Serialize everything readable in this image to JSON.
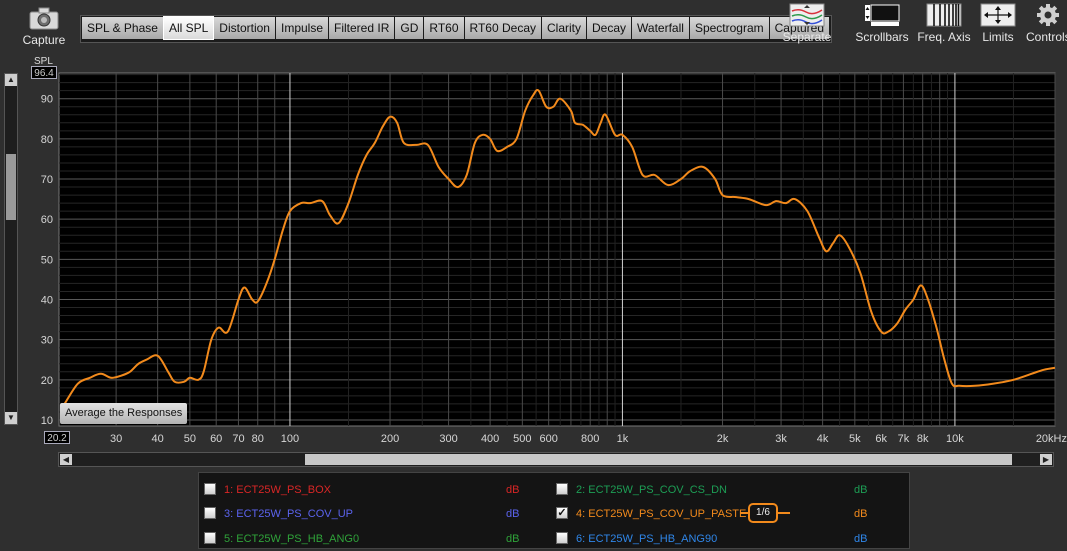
{
  "toolbar": {
    "capture_label": "Capture",
    "tabs": [
      {
        "label": "SPL & Phase",
        "active": false
      },
      {
        "label": "All SPL",
        "active": true
      },
      {
        "label": "Distortion",
        "active": false
      },
      {
        "label": "Impulse",
        "active": false
      },
      {
        "label": "Filtered IR",
        "active": false
      },
      {
        "label": "GD",
        "active": false
      },
      {
        "label": "RT60",
        "active": false
      },
      {
        "label": "RT60 Decay",
        "active": false
      },
      {
        "label": "Clarity",
        "active": false
      },
      {
        "label": "Decay",
        "active": false
      },
      {
        "label": "Waterfall",
        "active": false
      },
      {
        "label": "Spectrogram",
        "active": false
      },
      {
        "label": "Captured",
        "active": false
      }
    ],
    "tools": {
      "separate": {
        "label": "Separate",
        "icon": "separate-traces-icon"
      },
      "scrollbars": {
        "label": "Scrollbars",
        "icon": "scrollbars-icon"
      },
      "freq_axis": {
        "label": "Freq. Axis",
        "icon": "frequency-axis-icon"
      },
      "limits": {
        "label": "Limits",
        "icon": "limits-arrows-icon"
      },
      "controls": {
        "label": "Controls",
        "icon": "gear-icon"
      }
    }
  },
  "graph": {
    "y_unit": "SPL",
    "y_top_value": "96.4",
    "y_bottom_value": "20.2",
    "average_button": "Average the Responses"
  },
  "chart_data": {
    "type": "line",
    "x_scale": "log",
    "xlim": [
      20.2,
      20000
    ],
    "ylim": [
      8.5,
      96.4
    ],
    "xlabel": "",
    "ylabel": "SPL",
    "x_ticks": [
      {
        "value": 30,
        "label": "30"
      },
      {
        "value": 40,
        "label": "40"
      },
      {
        "value": 50,
        "label": "50"
      },
      {
        "value": 60,
        "label": "60"
      },
      {
        "value": 70,
        "label": "70"
      },
      {
        "value": 80,
        "label": "80"
      },
      {
        "value": 100,
        "label": "100"
      },
      {
        "value": 200,
        "label": "200"
      },
      {
        "value": 300,
        "label": "300"
      },
      {
        "value": 400,
        "label": "400"
      },
      {
        "value": 500,
        "label": "500"
      },
      {
        "value": 600,
        "label": "600"
      },
      {
        "value": 800,
        "label": "800"
      },
      {
        "value": 1000,
        "label": "1k"
      },
      {
        "value": 2000,
        "label": "2k"
      },
      {
        "value": 3000,
        "label": "3k"
      },
      {
        "value": 4000,
        "label": "4k"
      },
      {
        "value": 5000,
        "label": "5k"
      },
      {
        "value": 6000,
        "label": "6k"
      },
      {
        "value": 7000,
        "label": "7k"
      },
      {
        "value": 8000,
        "label": "8k"
      },
      {
        "value": 10000,
        "label": "10k"
      },
      {
        "value": 20000,
        "label": "20kHz"
      }
    ],
    "y_ticks": [
      10,
      20,
      30,
      40,
      50,
      60,
      70,
      80,
      90
    ],
    "grid": true,
    "series": [
      {
        "color": "#f28a1c",
        "points": [
          [
            21,
            14
          ],
          [
            23,
            19
          ],
          [
            25,
            20.5
          ],
          [
            27,
            21.5
          ],
          [
            29,
            20.5
          ],
          [
            31,
            21
          ],
          [
            33,
            22
          ],
          [
            35,
            24
          ],
          [
            37,
            25
          ],
          [
            40,
            26
          ],
          [
            43,
            22
          ],
          [
            45,
            19.5
          ],
          [
            48,
            19.5
          ],
          [
            50,
            20.5
          ],
          [
            53,
            20
          ],
          [
            55,
            22
          ],
          [
            58,
            30
          ],
          [
            61,
            33
          ],
          [
            65,
            32
          ],
          [
            70,
            40
          ],
          [
            73,
            43
          ],
          [
            77,
            40
          ],
          [
            80,
            39.5
          ],
          [
            85,
            44
          ],
          [
            90,
            50
          ],
          [
            95,
            57
          ],
          [
            100,
            62
          ],
          [
            108,
            64
          ],
          [
            115,
            64
          ],
          [
            125,
            64.5
          ],
          [
            132,
            61
          ],
          [
            140,
            59
          ],
          [
            150,
            64
          ],
          [
            160,
            71
          ],
          [
            170,
            76
          ],
          [
            180,
            79
          ],
          [
            190,
            83
          ],
          [
            200,
            85.5
          ],
          [
            210,
            84
          ],
          [
            220,
            79
          ],
          [
            240,
            78.5
          ],
          [
            260,
            78.5
          ],
          [
            280,
            73
          ],
          [
            300,
            70
          ],
          [
            320,
            68
          ],
          [
            340,
            71
          ],
          [
            360,
            79
          ],
          [
            380,
            81
          ],
          [
            400,
            80
          ],
          [
            420,
            77
          ],
          [
            450,
            78
          ],
          [
            480,
            80
          ],
          [
            510,
            87
          ],
          [
            540,
            91
          ],
          [
            560,
            92
          ],
          [
            590,
            88
          ],
          [
            620,
            88
          ],
          [
            650,
            90
          ],
          [
            700,
            87
          ],
          [
            720,
            84
          ],
          [
            760,
            83.5
          ],
          [
            800,
            82
          ],
          [
            830,
            81
          ],
          [
            860,
            84
          ],
          [
            890,
            86
          ],
          [
            950,
            81
          ],
          [
            1000,
            81
          ],
          [
            1070,
            78
          ],
          [
            1150,
            71
          ],
          [
            1250,
            71
          ],
          [
            1370,
            68.5
          ],
          [
            1500,
            70
          ],
          [
            1600,
            72
          ],
          [
            1750,
            73
          ],
          [
            1900,
            70
          ],
          [
            2000,
            66
          ],
          [
            2200,
            65.5
          ],
          [
            2400,
            65
          ],
          [
            2700,
            63.5
          ],
          [
            2900,
            64.5
          ],
          [
            3100,
            64
          ],
          [
            3300,
            65
          ],
          [
            3600,
            62
          ],
          [
            3900,
            55.5
          ],
          [
            4100,
            52
          ],
          [
            4300,
            54
          ],
          [
            4500,
            56
          ],
          [
            4800,
            53
          ],
          [
            5200,
            46.5
          ],
          [
            5600,
            37
          ],
          [
            6000,
            32
          ],
          [
            6300,
            32
          ],
          [
            6700,
            34
          ],
          [
            7100,
            37.5
          ],
          [
            7500,
            40
          ],
          [
            7900,
            43.5
          ],
          [
            8300,
            40
          ],
          [
            8800,
            33
          ],
          [
            9300,
            25
          ],
          [
            9800,
            19
          ],
          [
            10300,
            18.5
          ],
          [
            11500,
            18.5
          ],
          [
            13000,
            19
          ],
          [
            15000,
            20
          ],
          [
            17000,
            21.5
          ],
          [
            18500,
            22.5
          ],
          [
            20000,
            23
          ]
        ]
      }
    ]
  },
  "legend": {
    "items": [
      {
        "index": "1",
        "label": "1: ECT25W_PS_BOX",
        "unit": "dB",
        "color": "#d82626",
        "checked": false,
        "mark": ""
      },
      {
        "index": "2",
        "label": "2: ECT25W_PS_COV_CS_DN",
        "unit": "dB",
        "color": "#1d9e55",
        "checked": false,
        "mark": ""
      },
      {
        "index": "3",
        "label": "3: ECT25W_PS_COV_UP",
        "unit": "dB",
        "color": "#5b63ee",
        "checked": false,
        "mark": ""
      },
      {
        "index": "4",
        "label": "4: ECT25W_PS_COV_UP_PASTE",
        "unit": "dB",
        "color": "#f28a1c",
        "checked": true,
        "mark": "✓",
        "smoothing": "1/6"
      },
      {
        "index": "5",
        "label": "5: ECT25W_PS_HB_ANG0",
        "unit": "dB",
        "color": "#2fa33a",
        "checked": false,
        "mark": ""
      },
      {
        "index": "6",
        "label": "6: ECT25W_PS_HB_ANG90",
        "unit": "dB",
        "color": "#2f86e8",
        "checked": false,
        "mark": ""
      }
    ]
  },
  "scrollbars": {
    "up_arrow": "▲",
    "down_arrow": "▼",
    "left_arrow": "◀",
    "right_arrow": "▶"
  },
  "colors": {
    "background": "#2f2f2f",
    "plot_background": "#000000",
    "trace": "#f28a1c"
  }
}
